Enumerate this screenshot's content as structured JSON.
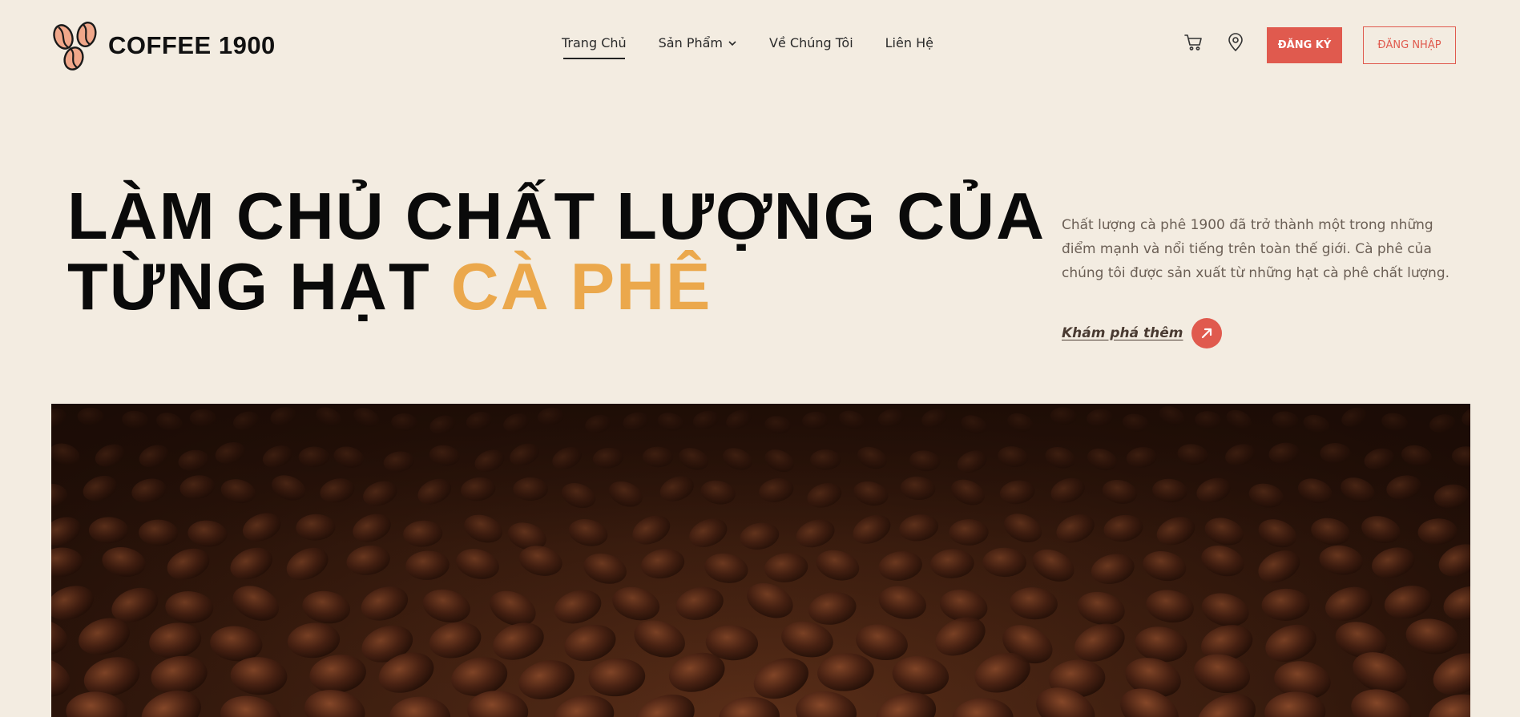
{
  "brand": {
    "name": "COFFEE 1900"
  },
  "nav": {
    "items": [
      {
        "label": "Trang Chủ",
        "active": true
      },
      {
        "label": "Sản Phẩm",
        "has_dropdown": true
      },
      {
        "label": "Về Chúng Tôi"
      },
      {
        "label": "Liên Hệ"
      }
    ]
  },
  "header_actions": {
    "cart_icon": "cart-icon",
    "location_icon": "map-pin-icon",
    "register_label": "ĐĂNG KÝ",
    "login_label": "ĐĂNG NHẬP"
  },
  "hero": {
    "title_line1": "LÀM CHỦ CHẤT LƯỢNG CỦA",
    "title_line2_plain": "TỪNG HẠT ",
    "title_line2_accent": "CÀ PHÊ",
    "description": "Chất lượng cà phê 1900 đã trở thành một trong những điểm mạnh và nổi tiếng trên toàn thế giới. Cà phê của chúng tôi được sản xuất từ những hạt cà phê chất lượng.",
    "cta_label": "Khám phá thêm",
    "cta_icon": "arrow-up-right-icon"
  },
  "colors": {
    "background": "#f3ece1",
    "accent_red": "#e05a4e",
    "accent_orange": "#eba84c",
    "text_dark": "#111111"
  }
}
